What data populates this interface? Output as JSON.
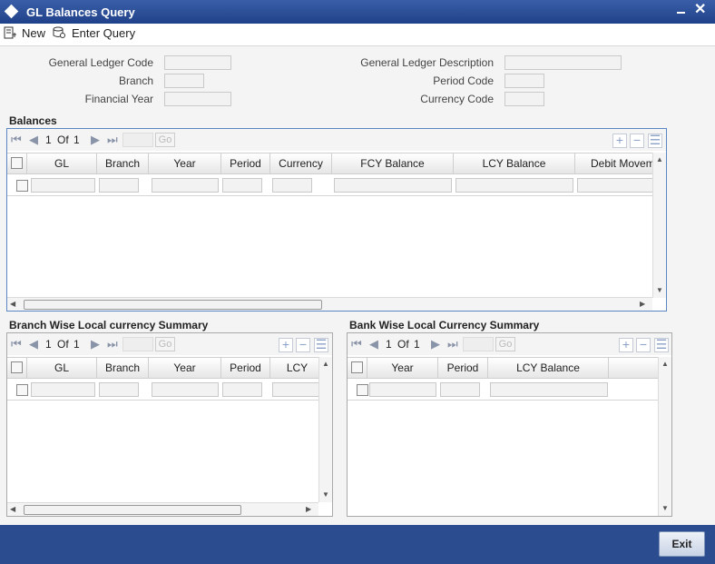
{
  "window": {
    "title": "GL Balances Query"
  },
  "toolbar": {
    "new_label": "New",
    "enter_query_label": "Enter Query"
  },
  "form": {
    "gl_code_label": "General Ledger Code",
    "branch_label": "Branch",
    "financial_year_label": "Financial Year",
    "gl_description_label": "General Ledger Description",
    "period_code_label": "Period Code",
    "currency_code_label": "Currency Code"
  },
  "balances": {
    "title": "Balances",
    "pager": {
      "current": "1",
      "of": "Of",
      "total": "1",
      "go": "Go"
    },
    "columns": [
      "GL",
      "Branch",
      "Year",
      "Period",
      "Currency",
      "FCY Balance",
      "LCY Balance",
      "Debit Movem"
    ]
  },
  "branch_summary": {
    "title": "Branch Wise Local currency Summary",
    "pager": {
      "current": "1",
      "of": "Of",
      "total": "1",
      "go": "Go"
    },
    "columns": [
      "GL",
      "Branch",
      "Year",
      "Period",
      "LCY"
    ]
  },
  "bank_summary": {
    "title": "Bank Wise Local Currency Summary",
    "pager": {
      "current": "1",
      "of": "Of",
      "total": "1",
      "go": "Go"
    },
    "columns": [
      "Year",
      "Period",
      "LCY Balance"
    ]
  },
  "footer": {
    "exit_label": "Exit"
  },
  "colors": {
    "title_bar": "#2b4c8f",
    "accent": "#5a86c4"
  }
}
